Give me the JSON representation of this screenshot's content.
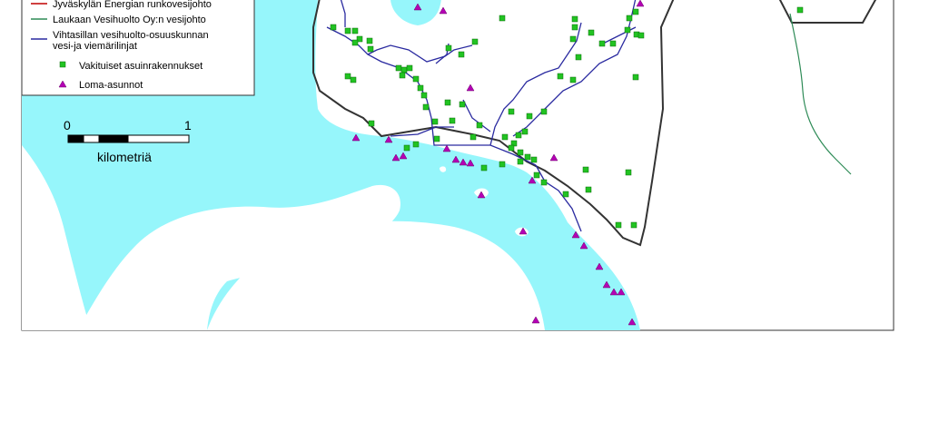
{
  "colors": {
    "water": "#96f6fb",
    "land": "#ffffff",
    "boundary": "#333333",
    "jyvaskyla_line": "#c00000",
    "laukaa_line": "#2e8b57",
    "vihtasilta_line": "#2a2aa0",
    "permanent_house": "#22c322",
    "holiday_house": "#b400b4"
  },
  "legend": {
    "items": [
      {
        "label": "Jyväskylän Energian runkovesijohto",
        "symbol": "red-line"
      },
      {
        "label": "Laukaan Vesihuolto Oy:n vesijohto",
        "symbol": "green-line"
      },
      {
        "label_line1": "Vihtasillan vesihuolto-osuuskunnan",
        "label_line2": "vesi-ja viemärilinjat",
        "symbol": "blue-line"
      },
      {
        "label": "Vakituiset asuinrakennukset",
        "symbol": "green-square"
      },
      {
        "label": "Loma-asunnot",
        "symbol": "purple-triangle"
      }
    ]
  },
  "scalebar": {
    "start_label": "0",
    "end_label": "1",
    "unit_label": "kilometriä"
  }
}
